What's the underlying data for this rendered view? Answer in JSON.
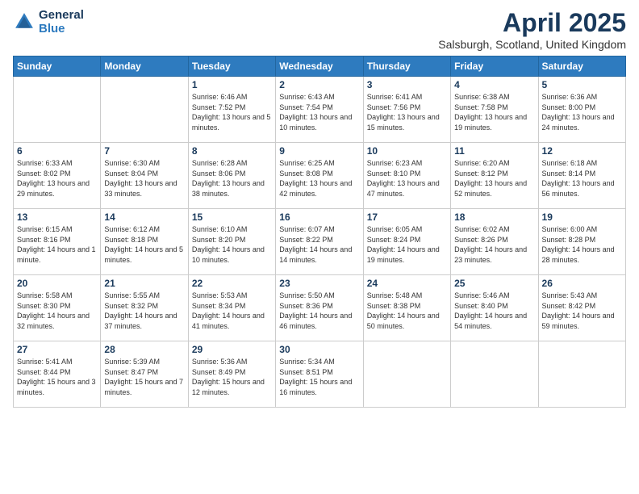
{
  "header": {
    "logo_line1": "General",
    "logo_line2": "Blue",
    "main_title": "April 2025",
    "subtitle": "Salsburgh, Scotland, United Kingdom"
  },
  "weekdays": [
    "Sunday",
    "Monday",
    "Tuesday",
    "Wednesday",
    "Thursday",
    "Friday",
    "Saturday"
  ],
  "weeks": [
    [
      {
        "day": "",
        "info": ""
      },
      {
        "day": "",
        "info": ""
      },
      {
        "day": "1",
        "info": "Sunrise: 6:46 AM\nSunset: 7:52 PM\nDaylight: 13 hours and 5 minutes."
      },
      {
        "day": "2",
        "info": "Sunrise: 6:43 AM\nSunset: 7:54 PM\nDaylight: 13 hours and 10 minutes."
      },
      {
        "day": "3",
        "info": "Sunrise: 6:41 AM\nSunset: 7:56 PM\nDaylight: 13 hours and 15 minutes."
      },
      {
        "day": "4",
        "info": "Sunrise: 6:38 AM\nSunset: 7:58 PM\nDaylight: 13 hours and 19 minutes."
      },
      {
        "day": "5",
        "info": "Sunrise: 6:36 AM\nSunset: 8:00 PM\nDaylight: 13 hours and 24 minutes."
      }
    ],
    [
      {
        "day": "6",
        "info": "Sunrise: 6:33 AM\nSunset: 8:02 PM\nDaylight: 13 hours and 29 minutes."
      },
      {
        "day": "7",
        "info": "Sunrise: 6:30 AM\nSunset: 8:04 PM\nDaylight: 13 hours and 33 minutes."
      },
      {
        "day": "8",
        "info": "Sunrise: 6:28 AM\nSunset: 8:06 PM\nDaylight: 13 hours and 38 minutes."
      },
      {
        "day": "9",
        "info": "Sunrise: 6:25 AM\nSunset: 8:08 PM\nDaylight: 13 hours and 42 minutes."
      },
      {
        "day": "10",
        "info": "Sunrise: 6:23 AM\nSunset: 8:10 PM\nDaylight: 13 hours and 47 minutes."
      },
      {
        "day": "11",
        "info": "Sunrise: 6:20 AM\nSunset: 8:12 PM\nDaylight: 13 hours and 52 minutes."
      },
      {
        "day": "12",
        "info": "Sunrise: 6:18 AM\nSunset: 8:14 PM\nDaylight: 13 hours and 56 minutes."
      }
    ],
    [
      {
        "day": "13",
        "info": "Sunrise: 6:15 AM\nSunset: 8:16 PM\nDaylight: 14 hours and 1 minute."
      },
      {
        "day": "14",
        "info": "Sunrise: 6:12 AM\nSunset: 8:18 PM\nDaylight: 14 hours and 5 minutes."
      },
      {
        "day": "15",
        "info": "Sunrise: 6:10 AM\nSunset: 8:20 PM\nDaylight: 14 hours and 10 minutes."
      },
      {
        "day": "16",
        "info": "Sunrise: 6:07 AM\nSunset: 8:22 PM\nDaylight: 14 hours and 14 minutes."
      },
      {
        "day": "17",
        "info": "Sunrise: 6:05 AM\nSunset: 8:24 PM\nDaylight: 14 hours and 19 minutes."
      },
      {
        "day": "18",
        "info": "Sunrise: 6:02 AM\nSunset: 8:26 PM\nDaylight: 14 hours and 23 minutes."
      },
      {
        "day": "19",
        "info": "Sunrise: 6:00 AM\nSunset: 8:28 PM\nDaylight: 14 hours and 28 minutes."
      }
    ],
    [
      {
        "day": "20",
        "info": "Sunrise: 5:58 AM\nSunset: 8:30 PM\nDaylight: 14 hours and 32 minutes."
      },
      {
        "day": "21",
        "info": "Sunrise: 5:55 AM\nSunset: 8:32 PM\nDaylight: 14 hours and 37 minutes."
      },
      {
        "day": "22",
        "info": "Sunrise: 5:53 AM\nSunset: 8:34 PM\nDaylight: 14 hours and 41 minutes."
      },
      {
        "day": "23",
        "info": "Sunrise: 5:50 AM\nSunset: 8:36 PM\nDaylight: 14 hours and 46 minutes."
      },
      {
        "day": "24",
        "info": "Sunrise: 5:48 AM\nSunset: 8:38 PM\nDaylight: 14 hours and 50 minutes."
      },
      {
        "day": "25",
        "info": "Sunrise: 5:46 AM\nSunset: 8:40 PM\nDaylight: 14 hours and 54 minutes."
      },
      {
        "day": "26",
        "info": "Sunrise: 5:43 AM\nSunset: 8:42 PM\nDaylight: 14 hours and 59 minutes."
      }
    ],
    [
      {
        "day": "27",
        "info": "Sunrise: 5:41 AM\nSunset: 8:44 PM\nDaylight: 15 hours and 3 minutes."
      },
      {
        "day": "28",
        "info": "Sunrise: 5:39 AM\nSunset: 8:47 PM\nDaylight: 15 hours and 7 minutes."
      },
      {
        "day": "29",
        "info": "Sunrise: 5:36 AM\nSunset: 8:49 PM\nDaylight: 15 hours and 12 minutes."
      },
      {
        "day": "30",
        "info": "Sunrise: 5:34 AM\nSunset: 8:51 PM\nDaylight: 15 hours and 16 minutes."
      },
      {
        "day": "",
        "info": ""
      },
      {
        "day": "",
        "info": ""
      },
      {
        "day": "",
        "info": ""
      }
    ]
  ]
}
